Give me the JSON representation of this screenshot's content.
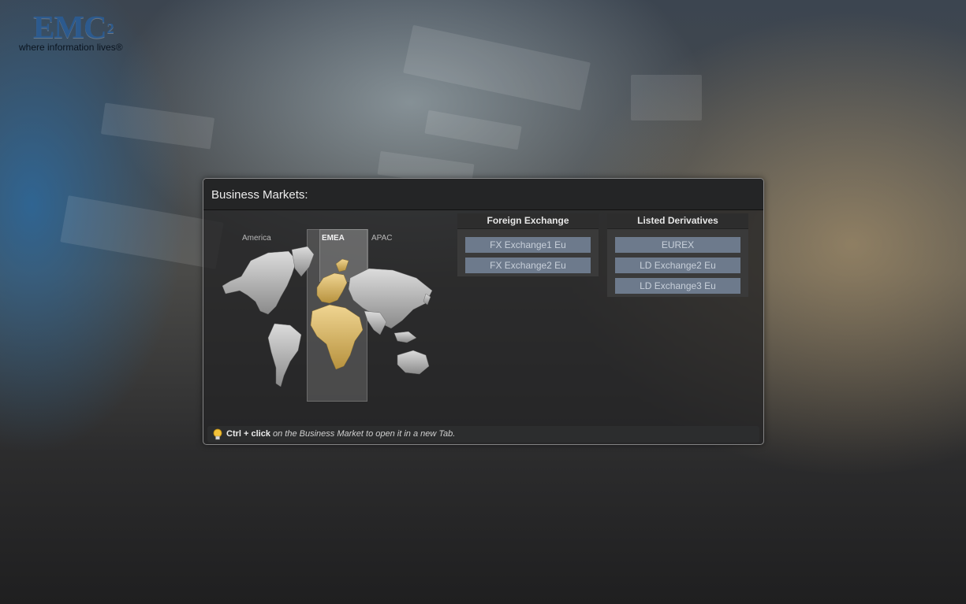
{
  "brand": {
    "logo": "EMC",
    "logo_sup": "2",
    "tagline": "where information lives®"
  },
  "panel": {
    "title": "Business Markets:"
  },
  "regions": {
    "america": "America",
    "emea": "EMEA",
    "apac": "APAC",
    "active": "EMEA"
  },
  "foreign_exchange": {
    "title": "Foreign Exchange",
    "items": [
      "FX Exchange1 Eu",
      "FX Exchange2 Eu"
    ]
  },
  "listed_derivatives": {
    "title": "Listed Derivatives",
    "items": [
      "EUREX",
      "LD Exchange2 Eu",
      "LD Exchange3 Eu"
    ]
  },
  "hint": {
    "icon": "lightbulb-icon",
    "bold": "Ctrl + click",
    "rest": " on the Business Market to open it in a new Tab."
  },
  "colors": {
    "accent_gold": "#d8b66a",
    "button_bg": "#6d7a8c",
    "logo_blue": "#2c5a8e"
  }
}
